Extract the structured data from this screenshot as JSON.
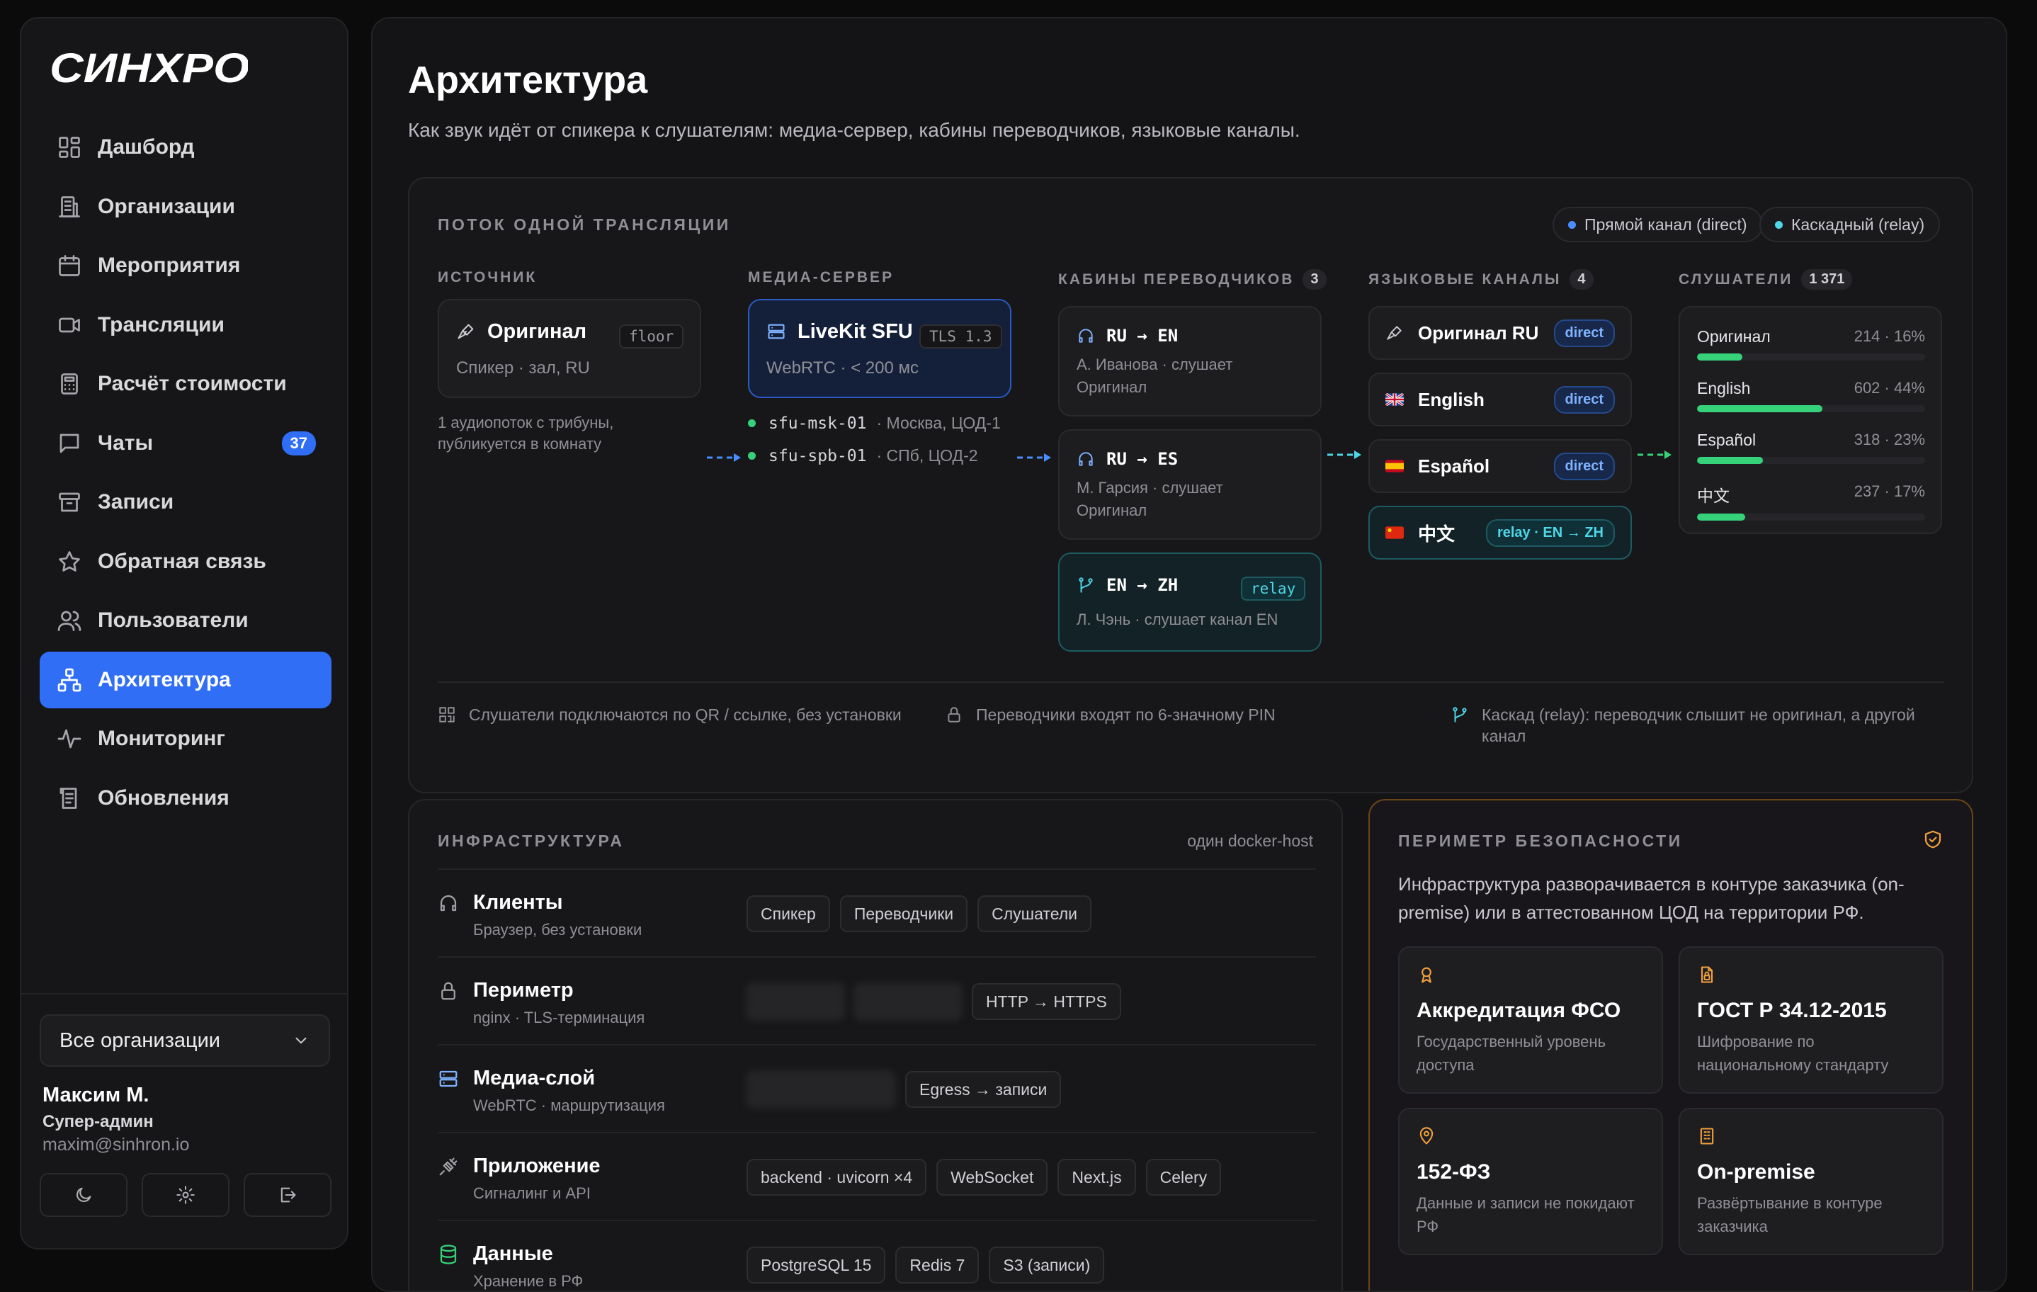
{
  "app": {
    "logo": "СИНХРОН"
  },
  "sidebar": {
    "items": [
      {
        "label": "Дашборд",
        "icon": "dashboard-icon"
      },
      {
        "label": "Организации",
        "icon": "building-icon"
      },
      {
        "label": "Мероприятия",
        "icon": "calendar-icon"
      },
      {
        "label": "Трансляции",
        "icon": "video-icon"
      },
      {
        "label": "Расчёт стоимости",
        "icon": "calculator-icon"
      },
      {
        "label": "Чаты",
        "icon": "chat-icon",
        "badge": "37"
      },
      {
        "label": "Записи",
        "icon": "archive-icon"
      },
      {
        "label": "Обратная связь",
        "icon": "star-icon"
      },
      {
        "label": "Пользователи",
        "icon": "users-icon"
      },
      {
        "label": "Архитектура",
        "icon": "network-icon",
        "active": true
      },
      {
        "label": "Мониторинг",
        "icon": "activity-icon"
      },
      {
        "label": "Обновления",
        "icon": "updates-icon"
      }
    ],
    "org_select": "Все организации",
    "user": {
      "name": "Максим М.",
      "role": "Супер-админ",
      "email": "maxim@sinhron.io"
    }
  },
  "page": {
    "title": "Архитектура",
    "subtitle": "Как звук идёт от спикера к слушателям: медиа-сервер, кабины переводчиков, языковые каналы."
  },
  "flow": {
    "label": "ПОТОК ОДНОЙ ТРАНСЛЯЦИИ",
    "legend_direct": "Прямой канал (direct)",
    "legend_relay": "Каскадный (relay)",
    "source": {
      "label": "ИСТОЧНИК",
      "title": "Оригинал",
      "tag": "floor",
      "sub": "Спикер · зал, RU",
      "note_1": "1 аудиопоток с трибуны,",
      "note_2": "публикуется в комнату"
    },
    "media": {
      "label": "МЕДИА-СЕРВЕР",
      "title": "LiveKit SFU",
      "tag": "TLS 1.3",
      "sub": "WebRTC · < 200 мс",
      "servers": [
        {
          "name": "sfu-msk-01",
          "loc": "· Москва, ЦОД-1"
        },
        {
          "name": "sfu-spb-01",
          "loc": "· СПб, ЦОД-2"
        }
      ]
    },
    "booths": {
      "label": "КАБИНЫ ПЕРЕВОДЧИКОВ",
      "count": "3",
      "items": [
        {
          "pair": "RU → EN",
          "sub_1": "А. Иванова · слушает",
          "sub_2": "Оригинал"
        },
        {
          "pair": "RU → ES",
          "sub_1": "М. Гарсия · слушает",
          "sub_2": "Оригинал"
        },
        {
          "pair": "EN → ZH",
          "tag": "relay",
          "sub_1": "Л. Чэнь · слушает канал EN"
        }
      ]
    },
    "channels": {
      "label": "ЯЗЫКОВЫЕ КАНАЛЫ",
      "count": "4",
      "items": [
        {
          "name": "Оригинал RU",
          "pill": "direct"
        },
        {
          "name": "English",
          "pill": "direct"
        },
        {
          "name": "Español",
          "pill": "direct"
        },
        {
          "name": "中文",
          "pill": "relay · EN → ZH"
        }
      ]
    },
    "listeners": {
      "label": "СЛУШАТЕЛИ",
      "count": "1 371",
      "items": [
        {
          "name": "Оригинал",
          "value": "214 · 16%",
          "share": 16
        },
        {
          "name": "English",
          "value": "602 · 44%",
          "share": 44
        },
        {
          "name": "Español",
          "value": "318 · 23%",
          "share": 23
        },
        {
          "name": "中文",
          "value": "237 · 17%",
          "share": 17
        }
      ]
    },
    "footer": {
      "qr": "Слушатели подключаются по QR / ссылке, без установки",
      "pin": "Переводчики входят по 6-значному PIN",
      "relay_1": "Каскад (relay): переводчик слышит не оригинал, а другой",
      "relay_2": "канал"
    }
  },
  "infra": {
    "label": "ИНФРАСТРУКТУРА",
    "host": "один docker-host",
    "rows": [
      {
        "title": "Клиенты",
        "sub": "Браузер, без установки",
        "chips": [
          "Спикер",
          "Переводчики",
          "Слушатели"
        ]
      },
      {
        "title": "Периметр",
        "sub": "nginx · TLS-терминация",
        "chips": [
          "HTTP → HTTPS"
        ]
      },
      {
        "title": "Медиа-слой",
        "sub": "WebRTC · маршрутизация",
        "chips": [
          "Egress → записи"
        ]
      },
      {
        "title": "Приложение",
        "sub": "Сигналинг и API",
        "chips": [
          "backend · uvicorn ×4",
          "WebSocket",
          "Next.js",
          "Celery"
        ]
      },
      {
        "title": "Данные",
        "sub": "Хранение в РФ",
        "chips": [
          "PostgreSQL 15",
          "Redis 7",
          "S3 (записи)"
        ]
      }
    ]
  },
  "security": {
    "label": "ПЕРИМЕТР БЕЗОПАСНОСТИ",
    "text": "Инфраструктура разворачивается в контуре заказчика (on-premise) или в аттестованном ЦОД на территории РФ.",
    "tiles": [
      {
        "title": "Аккредитация ФСО",
        "sub": "Государственный уровень доступа",
        "icon": "award-icon"
      },
      {
        "title": "ГОСТ Р 34.12-2015",
        "sub": "Шифрование по национальному стандарту",
        "icon": "file-lock-icon"
      },
      {
        "title": "152-ФЗ",
        "sub": "Данные и записи не покидают РФ",
        "icon": "map-pin-icon"
      },
      {
        "title": "On-premise",
        "sub": "Развёртывание в контуре заказчика",
        "icon": "server-building-icon"
      }
    ]
  },
  "colors": {
    "accent": "#2f6ef5",
    "green": "#36d27a",
    "relay": "#4fd6e8",
    "security": "#f2a03c"
  }
}
